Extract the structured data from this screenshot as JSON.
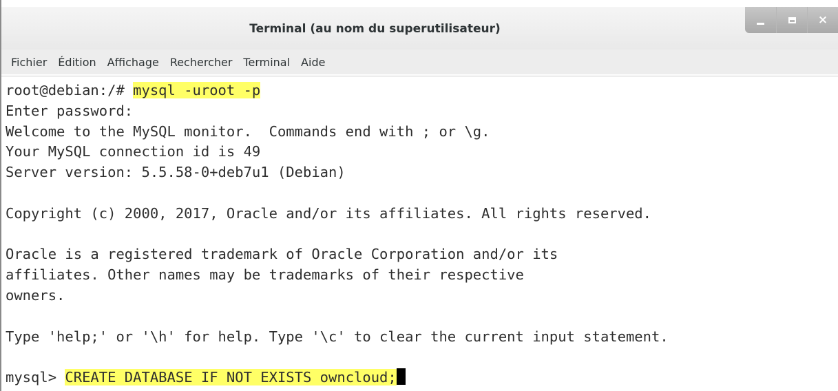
{
  "window": {
    "title": "Terminal (au nom du superutilisateur)",
    "controls": {
      "minimize": "minimize-icon",
      "maximize": "maximize-icon",
      "close_label": "×"
    }
  },
  "menubar": {
    "items": [
      "Fichier",
      "Édition",
      "Affichage",
      "Rechercher",
      "Terminal",
      "Aide"
    ]
  },
  "terminal": {
    "prompt1": "root@debian:/# ",
    "command1": "mysql -uroot -p",
    "lines": [
      "Enter password:",
      "Welcome to the MySQL monitor.  Commands end with ; or \\g.",
      "Your MySQL connection id is 49",
      "Server version: 5.5.58-0+deb7u1 (Debian)",
      "",
      "Copyright (c) 2000, 2017, Oracle and/or its affiliates. All rights reserved.",
      "",
      "Oracle is a registered trademark of Oracle Corporation and/or its",
      "affiliates. Other names may be trademarks of their respective",
      "owners.",
      "",
      "Type 'help;' or '\\h' for help. Type '\\c' to clear the current input statement.",
      ""
    ],
    "prompt2": "mysql> ",
    "command2": "CREATE DATABASE IF NOT EXISTS owncloud;"
  },
  "colors": {
    "highlight": "#ffff66",
    "titlebar": "#ececec",
    "menubar": "#ededed",
    "text": "#2e2e2e"
  }
}
